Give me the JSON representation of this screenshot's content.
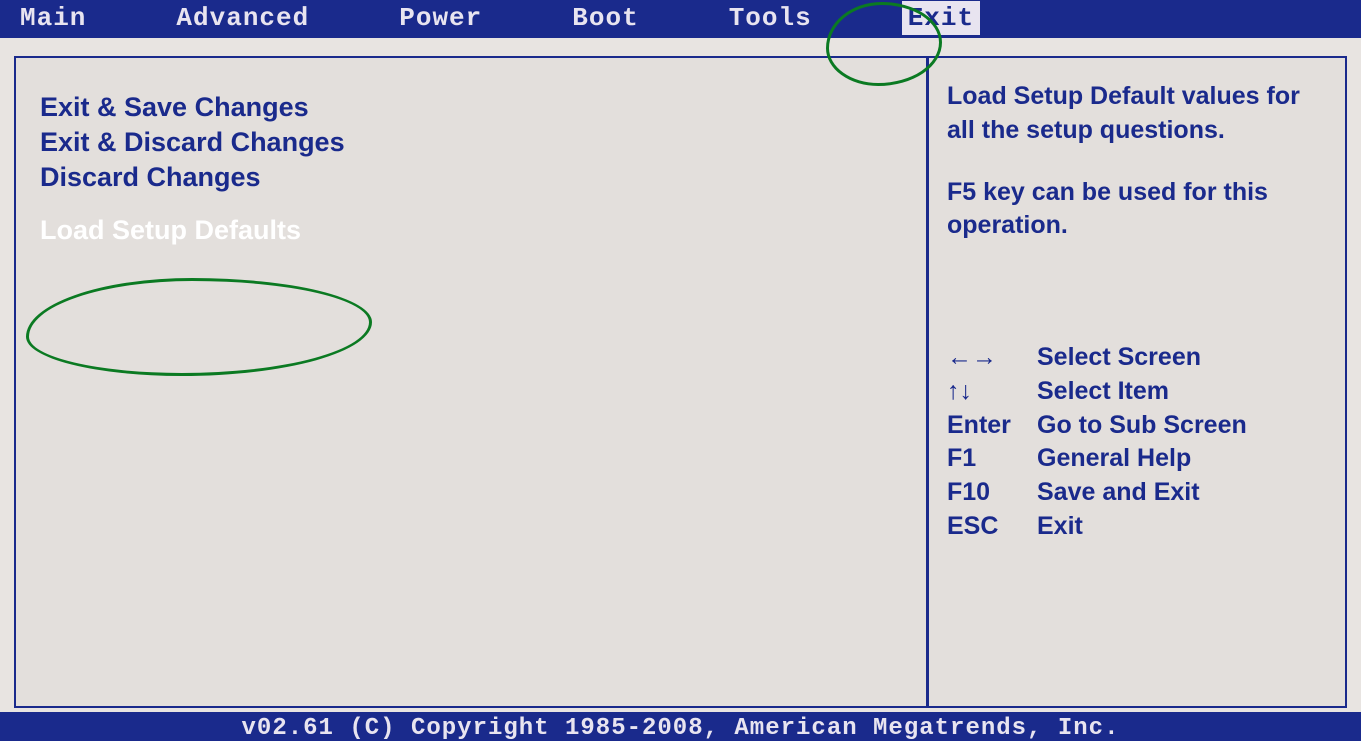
{
  "menubar": {
    "items": [
      "Main",
      "Advanced",
      "Power",
      "Boot",
      "Tools",
      "Exit"
    ],
    "active_index": 5
  },
  "menu": {
    "items": [
      {
        "label": "Exit & Save Changes",
        "selected": false
      },
      {
        "label": "Exit & Discard Changes",
        "selected": false
      },
      {
        "label": "Discard Changes",
        "selected": false
      },
      {
        "label": "Load Setup Defaults",
        "selected": true
      }
    ]
  },
  "help": {
    "para1": "Load Setup Default values for all the setup questions.",
    "para2": "F5 key can be used for this operation.",
    "keys": [
      {
        "key": "←→",
        "desc": "Select Screen"
      },
      {
        "key": "↑↓",
        "desc": "Select Item"
      },
      {
        "key": "Enter",
        "desc": "Go to Sub Screen"
      },
      {
        "key": "F1",
        "desc": "General Help"
      },
      {
        "key": "F10",
        "desc": "Save and Exit"
      },
      {
        "key": "ESC",
        "desc": "Exit"
      }
    ]
  },
  "footer": "v02.61 (C) Copyright 1985-2008, American Megatrends, Inc.",
  "annotations": {
    "circle_exit": "hand-drawn-circle-around-exit",
    "circle_load": "hand-drawn-circle-around-load-setup-defaults"
  }
}
